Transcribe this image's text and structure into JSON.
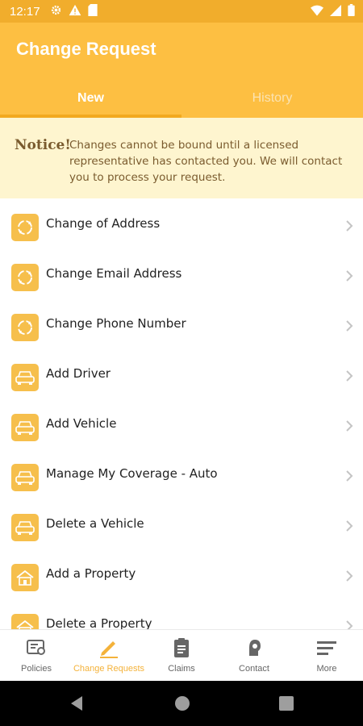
{
  "status_bar": {
    "time": "12:17"
  },
  "app_bar": {
    "title": "Change Request"
  },
  "tabs": [
    {
      "label": "New",
      "active": true
    },
    {
      "label": "History",
      "active": false
    }
  ],
  "notice": {
    "label": "Notice!",
    "text": "Changes cannot be bound until a licensed representative has contacted you. We will contact you to process your request."
  },
  "items": [
    {
      "label": "Change of Address",
      "icon": "refresh-icon"
    },
    {
      "label": "Change Email Address",
      "icon": "refresh-icon"
    },
    {
      "label": "Change Phone Number",
      "icon": "refresh-icon"
    },
    {
      "label": "Add Driver",
      "icon": "car-icon"
    },
    {
      "label": "Add Vehicle",
      "icon": "car-icon"
    },
    {
      "label": "Manage My Coverage - Auto",
      "icon": "car-icon"
    },
    {
      "label": "Delete a Vehicle",
      "icon": "car-icon"
    },
    {
      "label": "Add a Property",
      "icon": "house-icon"
    },
    {
      "label": "Delete a Property",
      "icon": "house-icon"
    }
  ],
  "bottom_nav": [
    {
      "label": "Policies",
      "icon": "policy-icon",
      "active": false
    },
    {
      "label": "Change Requests",
      "icon": "pencil-icon",
      "active": true
    },
    {
      "label": "Claims",
      "icon": "clipboard-icon",
      "active": false
    },
    {
      "label": "Contact",
      "icon": "headset-icon",
      "active": false
    },
    {
      "label": "More",
      "icon": "menu-icon",
      "active": false
    }
  ],
  "colors": {
    "status_bar": "#f1ad2c",
    "app_bar": "#fdbf42",
    "notice_bg": "#fef5cf",
    "accent": "#f6bf4c"
  }
}
